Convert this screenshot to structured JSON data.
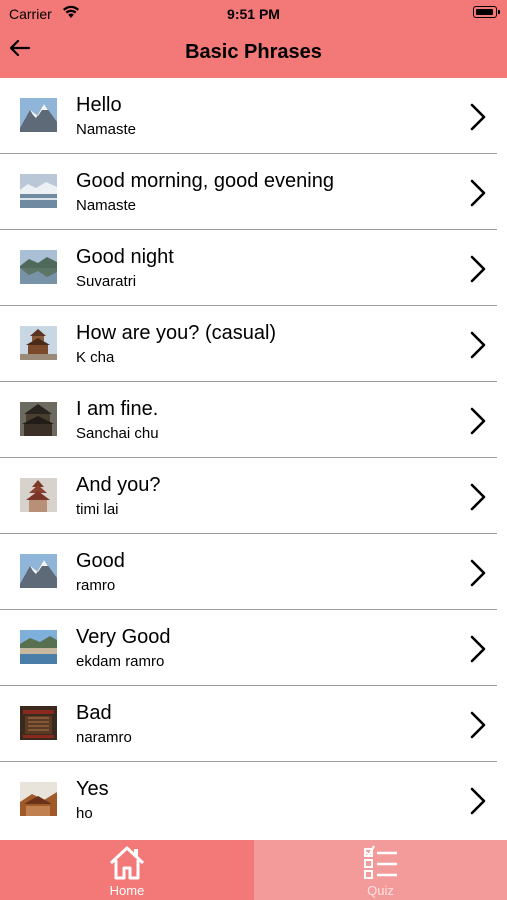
{
  "status_bar": {
    "carrier": "Carrier",
    "time": "9:51 PM"
  },
  "nav": {
    "title": "Basic Phrases"
  },
  "phrases": [
    {
      "phrase": "Hello",
      "translation": "Namaste",
      "thumb": "mountain-snow"
    },
    {
      "phrase": "Good morning, good evening",
      "translation": "Namaste",
      "thumb": "lake-snow"
    },
    {
      "phrase": "Good night",
      "translation": "Suvaratri",
      "thumb": "lake-reflection"
    },
    {
      "phrase": "How are you? (casual)",
      "translation": "K cha",
      "thumb": "pagoda-temple"
    },
    {
      "phrase": "I am fine.",
      "translation": "Sanchai chu",
      "thumb": "dark-temple"
    },
    {
      "phrase": "And you?",
      "translation": "timi lai",
      "thumb": "pagoda-tower"
    },
    {
      "phrase": "Good",
      "translation": "ramro",
      "thumb": "mountain-snow"
    },
    {
      "phrase": "Very Good",
      "translation": "ekdam ramro",
      "thumb": "lake-town"
    },
    {
      "phrase": "Bad",
      "translation": "naramro",
      "thumb": "carved-window"
    },
    {
      "phrase": "Yes",
      "translation": "ho",
      "thumb": "temple-rooftop"
    }
  ],
  "tabs": [
    {
      "label": "Home",
      "icon": "home-icon",
      "selected": true
    },
    {
      "label": "Quiz",
      "icon": "checklist-icon",
      "selected": false
    }
  ],
  "colors": {
    "header": "#f37878",
    "tab_selected": "#f37878",
    "tab_unselected": "#f39a9a",
    "separator": "#9c9c9c"
  }
}
